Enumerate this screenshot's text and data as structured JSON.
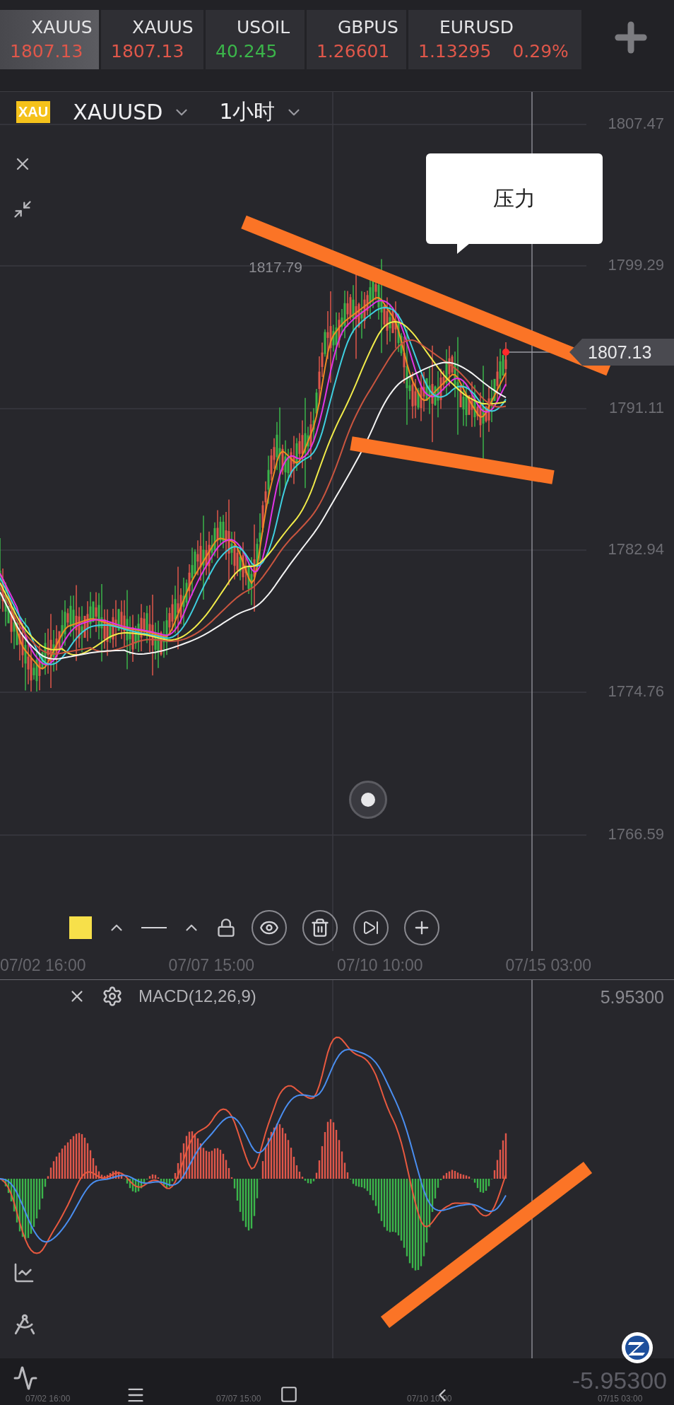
{
  "quote_tabs": [
    {
      "symbol": "XAUUS",
      "price": "1807.13",
      "color": "#e0574a",
      "selected": true
    },
    {
      "symbol": "XAUUS",
      "price": "1807.13",
      "color": "#e0574a",
      "selected": false
    },
    {
      "symbol": "USOIL",
      "price": "40.245",
      "color": "#3bb54a",
      "selected": false
    },
    {
      "symbol": "GBPUS",
      "price": "1.26601",
      "color": "#e0574a",
      "selected": false
    },
    {
      "symbol": "EURUSD",
      "price": "1.13295",
      "change": "0.29%",
      "color": "#e0574a",
      "selected": false
    }
  ],
  "chart_header": {
    "badge": "XAU",
    "symbol": "XAUUSD",
    "timeframe": "1小时"
  },
  "price_axis": [
    "1807.47",
    "1799.29",
    "1791.11",
    "1782.94",
    "1774.76",
    "1766.59"
  ],
  "current_price": "1807.13",
  "high_label": "1817.79",
  "callout": "压力",
  "time_axis": [
    "07/02 16:00",
    "07/07 15:00",
    "07/10 10:00",
    "07/15 03:00"
  ],
  "indicator": {
    "name": "MACD(12,26,9)",
    "max": "5.95300",
    "min": "-5.95300"
  },
  "mini_time_axis": [
    "07/02 16:00",
    "07/07 15:00",
    "07/10 10:00",
    "07/15 03:00"
  ]
}
